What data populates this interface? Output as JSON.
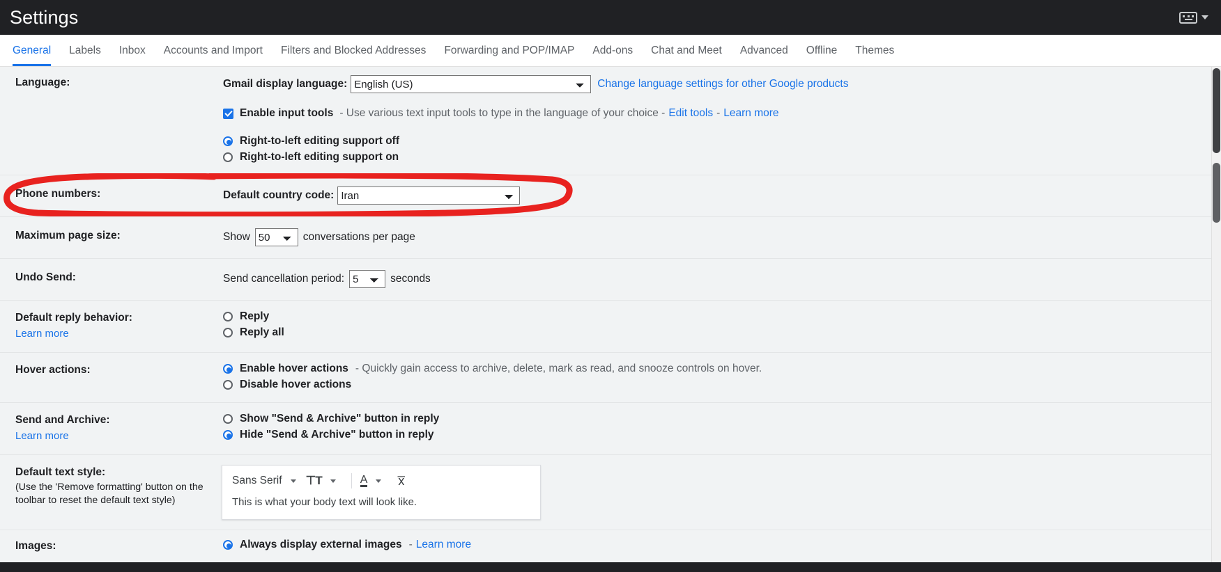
{
  "header": {
    "title": "Settings",
    "keyboard_icon": "keyboard-icon",
    "caret_icon": "chevron-down-icon"
  },
  "tabs": [
    {
      "label": "General",
      "active": true
    },
    {
      "label": "Labels",
      "active": false
    },
    {
      "label": "Inbox",
      "active": false
    },
    {
      "label": "Accounts and Import",
      "active": false
    },
    {
      "label": "Filters and Blocked Addresses",
      "active": false
    },
    {
      "label": "Forwarding and POP/IMAP",
      "active": false
    },
    {
      "label": "Add-ons",
      "active": false
    },
    {
      "label": "Chat and Meet",
      "active": false
    },
    {
      "label": "Advanced",
      "active": false
    },
    {
      "label": "Offline",
      "active": false
    },
    {
      "label": "Themes",
      "active": false
    }
  ],
  "settings": {
    "language": {
      "label": "Language:",
      "display_language_label": "Gmail display language:",
      "display_language_value": "English (US)",
      "change_language_link": "Change language settings for other Google products",
      "input_tools_label": "Enable input tools",
      "input_tools_desc": "- Use various text input tools to type in the language of your choice -",
      "edit_tools_link": "Edit tools",
      "dash": "-",
      "learn_more_link": "Learn more",
      "input_tools_checked": true,
      "rtl_off_label": "Right-to-left editing support off",
      "rtl_on_label": "Right-to-left editing support on",
      "rtl_selected": "off"
    },
    "phone_numbers": {
      "label": "Phone numbers:",
      "country_code_label": "Default country code:",
      "country_code_value": "Iran",
      "highlighted": true
    },
    "max_page_size": {
      "label": "Maximum page size:",
      "show_label": "Show",
      "value": "50",
      "suffix_label": "conversations per page"
    },
    "undo_send": {
      "label": "Undo Send:",
      "period_label": "Send cancellation period:",
      "value": "5",
      "suffix_label": "seconds"
    },
    "default_reply": {
      "label": "Default reply behavior:",
      "learn_more": "Learn more",
      "option_reply": "Reply",
      "option_reply_all": "Reply all",
      "selected": "none"
    },
    "hover_actions": {
      "label": "Hover actions:",
      "enable_label": "Enable hover actions",
      "enable_desc": "- Quickly gain access to archive, delete, mark as read, and snooze controls on hover.",
      "disable_label": "Disable hover actions",
      "selected": "enable"
    },
    "send_and_archive": {
      "label": "Send and Archive:",
      "learn_more": "Learn more",
      "show_label": "Show \"Send & Archive\" button in reply",
      "hide_label": "Hide \"Send & Archive\" button in reply",
      "selected": "hide"
    },
    "default_text_style": {
      "label": "Default text style:",
      "sub_label": "(Use the 'Remove formatting' button on the toolbar to reset the default text style)",
      "font_name": "Sans Serif",
      "size_icon": "text-size-icon",
      "color_icon": "text-color-icon",
      "clear_format_icon": "remove-formatting-icon",
      "preview_text": "This is what your body text will look like."
    },
    "images": {
      "label": "Images:",
      "always_display_label": "Always display external images",
      "dash": "-",
      "learn_more": "Learn more",
      "selected": "always"
    }
  },
  "annotation": {
    "type": "red-oval-highlight",
    "color": "#e8221f",
    "target": "phone-numbers-row"
  },
  "colors": {
    "header_bg": "#202124",
    "accent": "#1a73e8",
    "content_bg": "#f1f3f4",
    "annotation_red": "#e8221f"
  }
}
